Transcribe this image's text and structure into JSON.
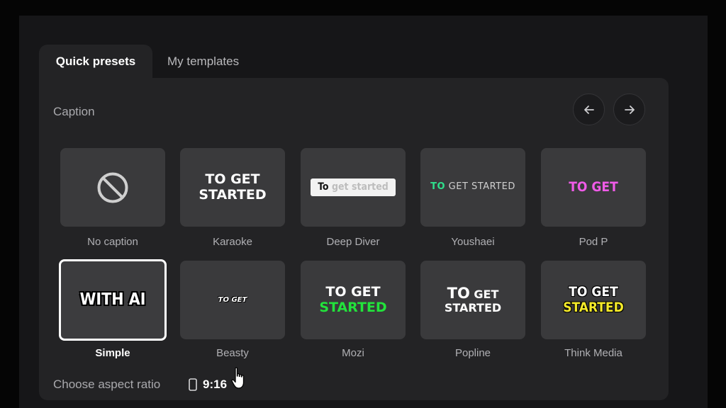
{
  "tabs": [
    {
      "label": "Quick presets",
      "active": true
    },
    {
      "label": "My templates",
      "active": false
    }
  ],
  "section": {
    "title": "Caption"
  },
  "nav": {
    "prev_icon": "arrow-left-icon",
    "next_icon": "arrow-right-icon"
  },
  "presets": [
    {
      "name": "No caption",
      "preview": {
        "icon": "no-entry-icon"
      }
    },
    {
      "name": "Karaoke",
      "preview": {
        "line1": "TO GET",
        "line2": "STARTED"
      }
    },
    {
      "name": "Deep Diver",
      "preview": {
        "word1": "To",
        "word2": "get started"
      }
    },
    {
      "name": "Youshaei",
      "preview": {
        "word1": "TO",
        "word2": "GET STARTED"
      }
    },
    {
      "name": "Pod P",
      "preview": {
        "text": "TO GET"
      }
    },
    {
      "name": "Simple",
      "selected": true,
      "preview": {
        "text": "WITH AI"
      }
    },
    {
      "name": "Beasty",
      "preview": {
        "text": "TO GET"
      }
    },
    {
      "name": "Mozi",
      "preview": {
        "line1": "TO GET",
        "line2": "STARTED"
      }
    },
    {
      "name": "Popline",
      "preview": {
        "word1": "TO",
        "word2": "GET",
        "line2": "STARTED"
      }
    },
    {
      "name": "Think Media",
      "preview": {
        "line1": "TO GET",
        "line2": "STARTED"
      }
    }
  ],
  "aspect_ratio": {
    "label": "Choose aspect ratio",
    "value": "9:16",
    "icon": "phone-portrait-icon"
  },
  "colors": {
    "background": "#050505",
    "panel": "#232325",
    "tile": "#3a3a3c",
    "mozi_green": "#22e33b",
    "youshaei_green": "#2fe08c",
    "podp_pink": "#f05be8",
    "popline_purple": "#7b3df2",
    "think_yellow": "#f4ea2a"
  }
}
